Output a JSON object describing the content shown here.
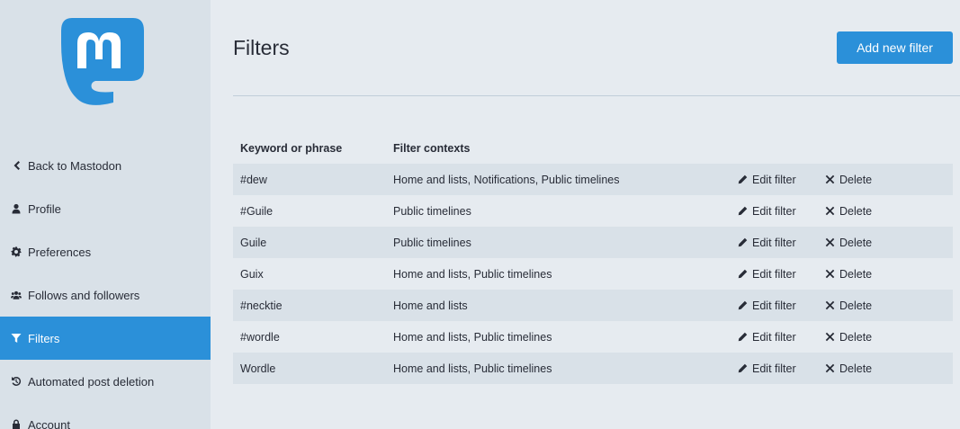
{
  "sidebar": {
    "items": [
      {
        "label": "Back to Mastodon",
        "icon": "chevron-left-icon"
      },
      {
        "label": "Profile",
        "icon": "user-icon"
      },
      {
        "label": "Preferences",
        "icon": "gear-icon"
      },
      {
        "label": "Follows and followers",
        "icon": "users-icon"
      },
      {
        "label": "Filters",
        "icon": "filter-icon",
        "active": true
      },
      {
        "label": "Automated post deletion",
        "icon": "history-icon"
      },
      {
        "label": "Account",
        "icon": "lock-icon"
      }
    ]
  },
  "main": {
    "title": "Filters",
    "add_button": "Add new filter"
  },
  "table": {
    "headers": {
      "keyword": "Keyword or phrase",
      "contexts": "Filter contexts"
    },
    "edit_label": "Edit filter",
    "delete_label": "Delete",
    "rows": [
      {
        "keyword": "#dew",
        "contexts": "Home and lists, Notifications, Public timelines"
      },
      {
        "keyword": "#Guile",
        "contexts": "Public timelines"
      },
      {
        "keyword": "Guile",
        "contexts": "Public timelines"
      },
      {
        "keyword": "Guix",
        "contexts": "Home and lists, Public timelines"
      },
      {
        "keyword": "#necktie",
        "contexts": "Home and lists"
      },
      {
        "keyword": "#wordle",
        "contexts": "Home and lists, Public timelines"
      },
      {
        "keyword": "Wordle",
        "contexts": "Home and lists, Public timelines"
      }
    ]
  },
  "colors": {
    "accent": "#2b90d9",
    "sidebar_bg": "#d9e1e8",
    "page_bg": "#e6ebf0"
  }
}
